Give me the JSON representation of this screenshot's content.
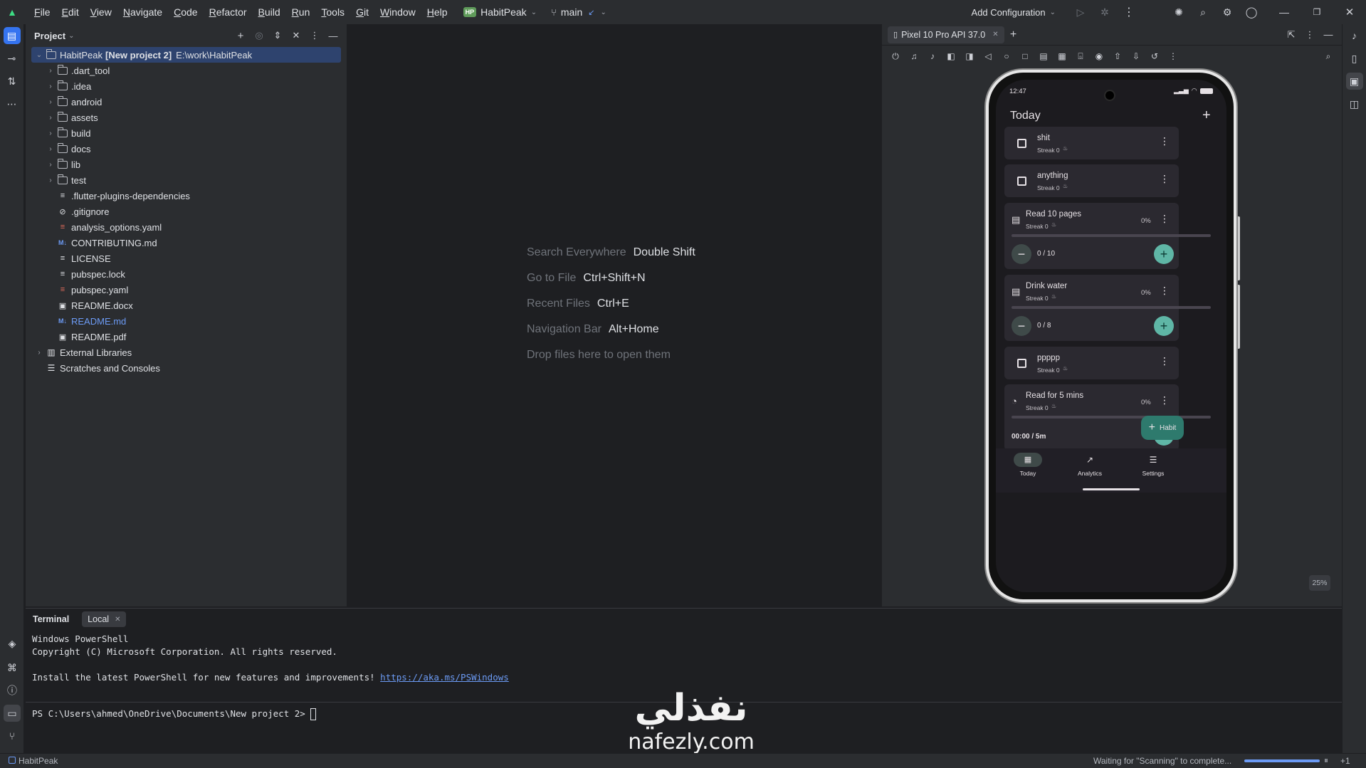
{
  "menu": {
    "items": [
      "File",
      "Edit",
      "View",
      "Navigate",
      "Code",
      "Refactor",
      "Build",
      "Run",
      "Tools",
      "Git",
      "Window",
      "Help"
    ],
    "underline": [
      "F",
      "E",
      "V",
      "N",
      "C",
      "R",
      "B",
      "R",
      "T",
      "G",
      "W",
      "H"
    ],
    "project_badge": "HP",
    "project_name": "HabitPeak",
    "branch": "main",
    "run_config": "Add Configuration"
  },
  "project_panel": {
    "title": "Project",
    "root": {
      "name": "HabitPeak",
      "tag": "[New project 2]",
      "path": "E:\\work\\HabitPeak"
    },
    "folders": [
      ".dart_tool",
      ".idea",
      "android",
      "assets",
      "build",
      "docs",
      "lib",
      "test"
    ],
    "files": [
      {
        "name": ".flutter-plugins-dependencies",
        "icon": "text-file-icon",
        "color": "#dfe1e5"
      },
      {
        "name": ".gitignore",
        "icon": "ignore-file-icon",
        "color": "#dfe1e5"
      },
      {
        "name": "analysis_options.yaml",
        "icon": "yaml-file-icon",
        "color": "#dfe1e5"
      },
      {
        "name": "CONTRIBUTING.md",
        "icon": "markdown-file-icon",
        "color": "#dfe1e5"
      },
      {
        "name": "LICENSE",
        "icon": "text-file-icon",
        "color": "#dfe1e5"
      },
      {
        "name": "pubspec.lock",
        "icon": "text-file-icon",
        "color": "#dfe1e5"
      },
      {
        "name": "pubspec.yaml",
        "icon": "yaml-file-icon",
        "color": "#dfe1e5"
      },
      {
        "name": "README.docx",
        "icon": "binary-file-icon",
        "color": "#dfe1e5"
      },
      {
        "name": "README.md",
        "icon": "markdown-file-icon",
        "color": "#6c9bf5"
      },
      {
        "name": "README.pdf",
        "icon": "binary-file-icon",
        "color": "#dfe1e5"
      }
    ],
    "external": "External Libraries",
    "scratches": "Scratches and Consoles"
  },
  "editor_hints": [
    {
      "label": "Search Everywhere",
      "key": "Double Shift"
    },
    {
      "label": "Go to File",
      "key": "Ctrl+Shift+N"
    },
    {
      "label": "Recent Files",
      "key": "Ctrl+E"
    },
    {
      "label": "Navigation Bar",
      "key": "Alt+Home"
    },
    {
      "label": "Drop files here to open them",
      "key": ""
    }
  ],
  "device": {
    "tab_label": "Pixel 10 Pro API 37.0",
    "zoom": "25%",
    "app": {
      "time": "12:47",
      "title": "Today",
      "habits": [
        {
          "name": "shit",
          "streak": "Streak 0"
        },
        {
          "name": "anything",
          "streak": "Streak 0"
        },
        {
          "name": "Read 10 pages",
          "streak": "Streak 0",
          "percent": "0%",
          "count": "0 / 10",
          "progress": 0
        },
        {
          "name": "Drink water",
          "streak": "Streak 0",
          "percent": "0%",
          "count": "0 / 8",
          "progress": 0
        },
        {
          "name": "ppppp",
          "streak": "Streak 0"
        },
        {
          "name": "Read for 5 mins",
          "streak": "Streak 0",
          "percent": "0%",
          "timer": "00:00 / 5m",
          "progress": 0
        }
      ],
      "fab_label": "Habit",
      "nav": [
        "Today",
        "Analytics",
        "Settings"
      ]
    }
  },
  "terminal": {
    "tab_title": "Terminal",
    "session_tab": "Local",
    "lines": [
      "Windows PowerShell",
      "Copyright (C) Microsoft Corporation. All rights reserved.",
      "",
      "Install the latest PowerShell for new features and improvements! "
    ],
    "link": "https://aka.ms/PSWindows",
    "prompt": "PS C:\\Users\\ahmed\\OneDrive\\Documents\\New project 2> "
  },
  "status": {
    "project": "HabitPeak",
    "task": "Waiting for \"Scanning\" to complete...",
    "extra": "+1"
  },
  "watermark": {
    "arabic": "نفذلي",
    "domain": "nafezly.com"
  },
  "colors": {
    "accent": "#3574f0",
    "app_accent": "#5fb6a6",
    "selection": "#2e436e"
  }
}
